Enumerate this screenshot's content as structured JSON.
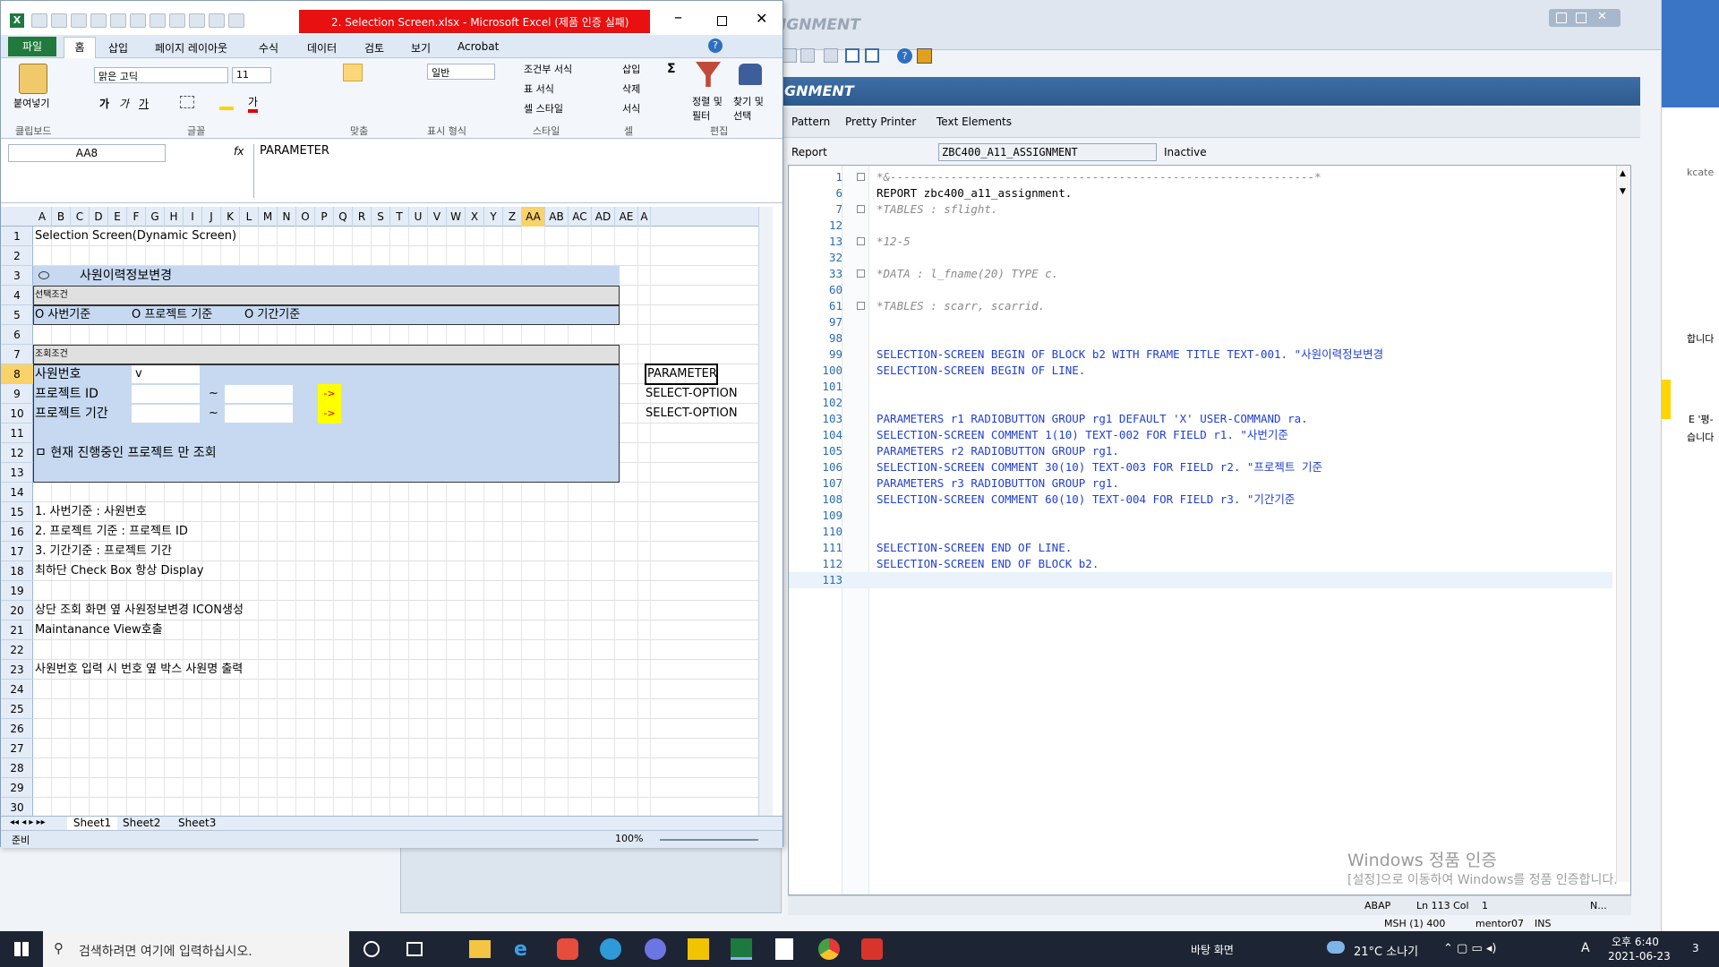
{
  "sap": {
    "title_fragment": "IGNMENT",
    "subheader": "GNMENT",
    "tabs": [
      "Pattern",
      "Pretty Printer",
      "Text Elements"
    ],
    "report_label": "Report",
    "report_value": "ZBC400_A11_ASSIGNMENT",
    "report_status": "Inactive",
    "status_bar": {
      "lang": "ABAP",
      "pos": "Ln 113 Col",
      "col": "1",
      "n": "N...",
      "system": "MSH (1) 400",
      "user": "mentor07",
      "mode": "INS"
    },
    "code": [
      {
        "n": "1",
        "t": "*&---------------------------------------------------------------*",
        "c": "cm",
        "fold": true
      },
      {
        "n": "6",
        "t": "REPORT zbc400_a11_assignment.",
        "c": "mix1"
      },
      {
        "n": "7",
        "t": "*TABLES : sflight.",
        "c": "cm",
        "fold": true
      },
      {
        "n": "12",
        "t": "",
        "c": ""
      },
      {
        "n": "13",
        "t": "*12-5",
        "c": "cm",
        "fold": true
      },
      {
        "n": "32",
        "t": "",
        "c": ""
      },
      {
        "n": "33",
        "t": "*DATA : l_fname(20) TYPE c.",
        "c": "cm",
        "fold": true
      },
      {
        "n": "60",
        "t": "",
        "c": ""
      },
      {
        "n": "61",
        "t": "*TABLES : scarr, scarrid.",
        "c": "cm",
        "fold": true
      },
      {
        "n": "97",
        "t": "",
        "c": ""
      },
      {
        "n": "98",
        "t": "",
        "c": ""
      },
      {
        "n": "99",
        "t": "SELECTION-SCREEN BEGIN OF BLOCK b2 WITH FRAME TITLE TEXT-001. \"사원이력정보변경",
        "c": "kw"
      },
      {
        "n": "100",
        "t": "SELECTION-SCREEN BEGIN OF LINE.",
        "c": "kw"
      },
      {
        "n": "101",
        "t": "",
        "c": ""
      },
      {
        "n": "102",
        "t": "",
        "c": ""
      },
      {
        "n": "103",
        "t": "PARAMETERS r1 RADIOBUTTON GROUP rg1 DEFAULT 'X' USER-COMMAND ra.",
        "c": "kw"
      },
      {
        "n": "104",
        "t": "SELECTION-SCREEN COMMENT 1(10) TEXT-002 FOR FIELD r1. \"사번기준",
        "c": "kw"
      },
      {
        "n": "105",
        "t": "PARAMETERS r2 RADIOBUTTON GROUP rg1.",
        "c": "kw"
      },
      {
        "n": "106",
        "t": "SELECTION-SCREEN COMMENT 30(10) TEXT-003 FOR FIELD r2. \"프로젝트 기준",
        "c": "kw"
      },
      {
        "n": "107",
        "t": "PARAMETERS r3 RADIOBUTTON GROUP rg1.",
        "c": "kw"
      },
      {
        "n": "108",
        "t": "SELECTION-SCREEN COMMENT 60(10) TEXT-004 FOR FIELD r3. \"기간기준",
        "c": "kw"
      },
      {
        "n": "109",
        "t": "",
        "c": ""
      },
      {
        "n": "110",
        "t": "",
        "c": ""
      },
      {
        "n": "111",
        "t": "SELECTION-SCREEN END OF LINE.",
        "c": "kw"
      },
      {
        "n": "112",
        "t": "SELECTION-SCREEN END OF BLOCK b2.",
        "c": "kw"
      },
      {
        "n": "113",
        "t": "",
        "c": "cur"
      }
    ],
    "watermark1": "Windows 정품 인증",
    "watermark2": "[설정]으로 이동하여 Windows를 정품 인증합니다."
  },
  "excel": {
    "title": "2. Selection Screen.xlsx  -  Microsoft Excel (제품 인증 실패)",
    "menu": [
      "파일",
      "홈",
      "삽입",
      "페이지 레이아웃",
      "수식",
      "데이터",
      "검토",
      "보기",
      "Acrobat"
    ],
    "font_name": "맑은 고딕",
    "font_size": "11",
    "number_format": "일반",
    "groups": [
      "클립보드",
      "글꼴",
      "맞춤",
      "표시 형식",
      "스타일",
      "셀",
      "편집"
    ],
    "ribbon_labels": {
      "paste": "붙여넣기",
      "cond": "조건부 서식",
      "table": "표 서식",
      "cellstyle": "셀 스타일",
      "insert": "삽입",
      "delete": "삭제",
      "format": "서식",
      "sort": "정렬 및 필터",
      "find": "찾기 및 선택",
      "sigma": "Σ"
    },
    "name_box": "AA8",
    "fx": "fx",
    "formula": "PARAMETER",
    "columns": [
      "A",
      "B",
      "C",
      "D",
      "E",
      "F",
      "G",
      "H",
      "I",
      "J",
      "K",
      "L",
      "M",
      "N",
      "O",
      "P",
      "Q",
      "R",
      "S",
      "T",
      "U",
      "V",
      "W",
      "X",
      "Y",
      "Z",
      "AA",
      "AB",
      "AC",
      "AD",
      "AE",
      "A"
    ],
    "rows": [
      "1",
      "2",
      "3",
      "4",
      "5",
      "6",
      "7",
      "8",
      "9",
      "10",
      "11",
      "12",
      "13",
      "14",
      "15",
      "16",
      "17",
      "18",
      "19",
      "20",
      "21",
      "22",
      "23",
      "24",
      "25",
      "26",
      "27",
      "28",
      "29",
      "30"
    ],
    "cells": {
      "r1": "Selection Screen(Dynamic Screen)",
      "r3": "사원이력정보변경",
      "r4": "선택조건",
      "r5a": "O 사번기준",
      "r5b": "O 프로젝트 기준",
      "r5c": "O 기간기준",
      "r7": "조회조건",
      "r8": "사원번호",
      "r8v": "v",
      "r9": "프로젝트 ID",
      "r10": "프로젝트 기간",
      "tilde": "~",
      "arrow": "->",
      "r12": "ㅁ 현재 진행중인 프로젝트 만 조회",
      "aa8": "PARAMETER",
      "aa9": "SELECT-OPTION",
      "aa10": "SELECT-OPTION",
      "r15": "1. 사번기준 : 사원번호",
      "r16": "2. 프로젝트 기준 : 프로젝트 ID",
      "r17": "3. 기간기준 : 프로젝트 기간",
      "r18": "최하단 Check Box 항상 Display",
      "r20": "상단 조회 화면 옆 사원정보변경 ICON생성",
      "r21": "Maintanance View호출",
      "r23": "사원번호 입력 시 번호 옆 박스 사원명 출력"
    },
    "sheets": [
      "Sheet1",
      "Sheet2",
      "Sheet3"
    ],
    "status": "준비",
    "zoom": "100%"
  },
  "taskbar": {
    "search_placeholder": "검색하려면 여기에 입력하십시오.",
    "desktop": "바탕 화면",
    "weather": "21°C 소나기",
    "ime": "A",
    "time": "오후 6:40",
    "date": "2021-06-23",
    "notif": "3"
  },
  "right_edge": {
    "t1": "kcate",
    "t2": "합니다",
    "t3": "E '평-",
    "t4": "습니다"
  }
}
